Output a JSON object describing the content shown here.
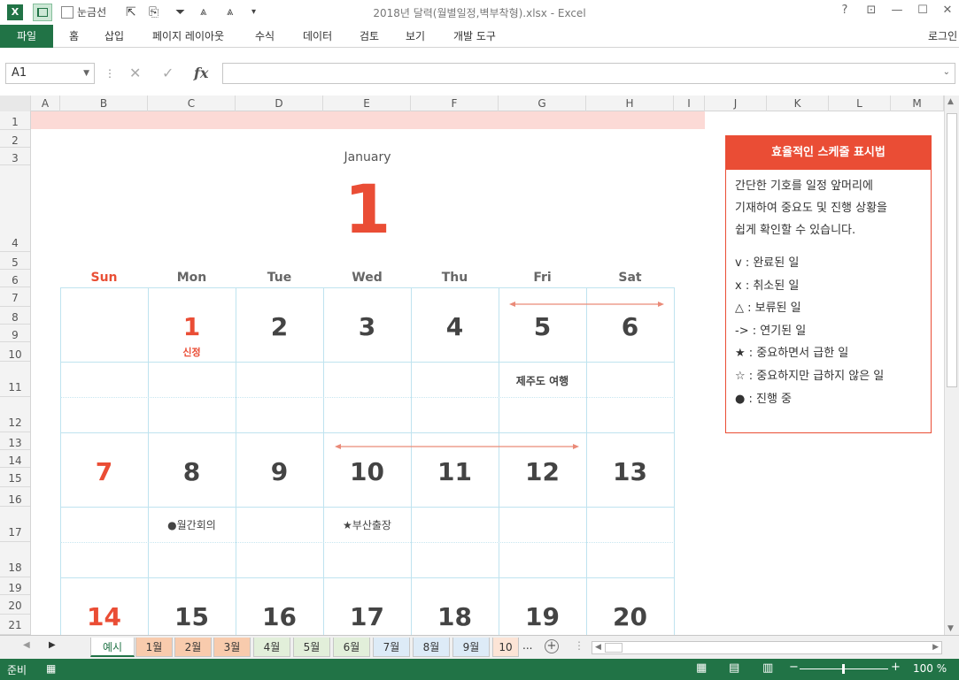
{
  "window": {
    "title": "2018년 달력(월별일정,벽부착형).xlsx - Excel",
    "help": "?",
    "login": "로그인"
  },
  "qat": {
    "gridlines_label": "눈금선"
  },
  "ribbon": {
    "tabs": [
      "파일",
      "홈",
      "삽입",
      "페이지 레이아웃",
      "수식",
      "데이터",
      "검토",
      "보기",
      "개발 도구"
    ]
  },
  "formula_bar": {
    "name_box": "A1",
    "value": "",
    "fx": "fx"
  },
  "columns": [
    "A",
    "B",
    "C",
    "D",
    "E",
    "F",
    "G",
    "H",
    "I",
    "J",
    "K",
    "L",
    "M"
  ],
  "rows": [
    "1",
    "2",
    "3",
    "4",
    "5",
    "6",
    "7",
    "8",
    "9",
    "10",
    "11",
    "12",
    "13",
    "14",
    "15",
    "16",
    "17",
    "18",
    "19",
    "20",
    "21"
  ],
  "calendar": {
    "month_name": "January",
    "month_number": "1",
    "weekdays": [
      "Sun",
      "Mon",
      "Tue",
      "Wed",
      "Thu",
      "Fri",
      "Sat"
    ],
    "week1": [
      "",
      "1",
      "2",
      "3",
      "4",
      "5",
      "6"
    ],
    "week2": [
      "7",
      "8",
      "9",
      "10",
      "11",
      "12",
      "13"
    ],
    "week3": [
      "14",
      "15",
      "16",
      "17",
      "18",
      "19",
      "20"
    ],
    "notes": {
      "new_year": "신정",
      "jeju": "제주도 여행",
      "meeting": "●월간회의",
      "busan": "★부산출장"
    }
  },
  "legend": {
    "title": "효율적인 스케줄 표시법",
    "desc": [
      "간단한 기호를 일정 앞머리에",
      "기재하여 중요도 및 진행 상황을",
      "쉽게 확인할 수 있습니다."
    ],
    "items": [
      "v : 완료된 일",
      "x : 취소된 일",
      "△ : 보류된 일",
      "-> : 연기된 일",
      "★ : 중요하면서 급한 일",
      "☆ : 중요하지만 급하지 않은 일",
      "● : 진행 중"
    ]
  },
  "sheet_tabs": [
    "예시",
    "1월",
    "2월",
    "3월",
    "4월",
    "5월",
    "6월",
    "7월",
    "8월",
    "9월",
    "10"
  ],
  "sheet_tab_colors": [
    "#fff2cc",
    "#f8cbad",
    "#f8cbad",
    "#f8cbad",
    "#e2efda",
    "#e2efda",
    "#e2efda",
    "#ddebf7",
    "#ddebf7",
    "#ddebf7",
    "#fce4d6"
  ],
  "status": {
    "ready": "준비",
    "zoom": "100 %"
  },
  "colors": {
    "accent": "#ea4d35",
    "excel_green": "#217346",
    "grid_line": "#bfe3ef"
  }
}
